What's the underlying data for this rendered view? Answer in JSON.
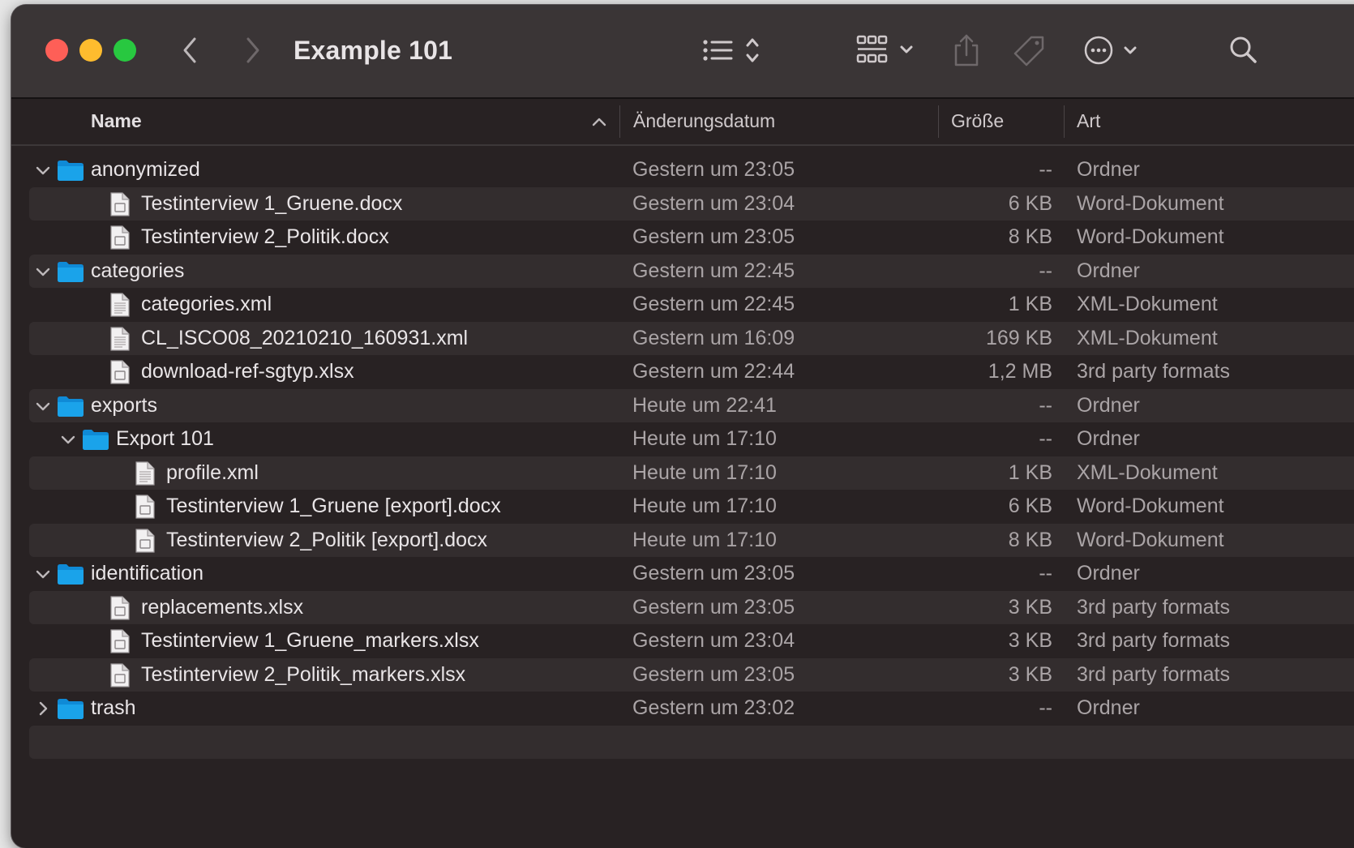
{
  "window": {
    "title": "Example 101"
  },
  "columns": {
    "name": "Name",
    "date": "Änderungsdatum",
    "size": "Größe",
    "kind": "Art"
  },
  "rows": [
    {
      "name": "anonymized",
      "date": "Gestern um 23:05",
      "size": "--",
      "kind": "Ordner",
      "type": "folder",
      "depth": 0,
      "expanded": true
    },
    {
      "name": "Testinterview 1_Gruene.docx",
      "date": "Gestern um 23:04",
      "size": "6 KB",
      "kind": "Word-Dokument",
      "type": "doc",
      "depth": 1
    },
    {
      "name": "Testinterview 2_Politik.docx",
      "date": "Gestern um 23:05",
      "size": "8 KB",
      "kind": "Word-Dokument",
      "type": "doc",
      "depth": 1
    },
    {
      "name": "categories",
      "date": "Gestern um 22:45",
      "size": "--",
      "kind": "Ordner",
      "type": "folder",
      "depth": 0,
      "expanded": true
    },
    {
      "name": "categories.xml",
      "date": "Gestern um 22:45",
      "size": "1 KB",
      "kind": "XML-Dokument",
      "type": "text",
      "depth": 1
    },
    {
      "name": "CL_ISCO08_20210210_160931.xml",
      "date": "Gestern um 16:09",
      "size": "169 KB",
      "kind": "XML-Dokument",
      "type": "text",
      "depth": 1
    },
    {
      "name": "download-ref-sgtyp.xlsx",
      "date": "Gestern um 22:44",
      "size": "1,2 MB",
      "kind": "3rd party formats",
      "type": "doc",
      "depth": 1
    },
    {
      "name": "exports",
      "date": "Heute um 22:41",
      "size": "--",
      "kind": "Ordner",
      "type": "folder",
      "depth": 0,
      "expanded": true
    },
    {
      "name": "Export 101",
      "date": "Heute um 17:10",
      "size": "--",
      "kind": "Ordner",
      "type": "folder",
      "depth": 1,
      "expanded": true
    },
    {
      "name": "profile.xml",
      "date": "Heute um 17:10",
      "size": "1 KB",
      "kind": "XML-Dokument",
      "type": "text",
      "depth": 2
    },
    {
      "name": "Testinterview 1_Gruene [export].docx",
      "date": "Heute um 17:10",
      "size": "6 KB",
      "kind": "Word-Dokument",
      "type": "doc",
      "depth": 2
    },
    {
      "name": "Testinterview 2_Politik [export].docx",
      "date": "Heute um 17:10",
      "size": "8 KB",
      "kind": "Word-Dokument",
      "type": "doc",
      "depth": 2
    },
    {
      "name": "identification",
      "date": "Gestern um 23:05",
      "size": "--",
      "kind": "Ordner",
      "type": "folder",
      "depth": 0,
      "expanded": true
    },
    {
      "name": "replacements.xlsx",
      "date": "Gestern um 23:05",
      "size": "3 KB",
      "kind": "3rd party formats",
      "type": "doc",
      "depth": 1
    },
    {
      "name": "Testinterview 1_Gruene_markers.xlsx",
      "date": "Gestern um 23:04",
      "size": "3 KB",
      "kind": "3rd party formats",
      "type": "doc",
      "depth": 1
    },
    {
      "name": "Testinterview 2_Politik_markers.xlsx",
      "date": "Gestern um 23:05",
      "size": "3 KB",
      "kind": "3rd party formats",
      "type": "doc",
      "depth": 1
    },
    {
      "name": "trash",
      "date": "Gestern um 23:02",
      "size": "--",
      "kind": "Ordner",
      "type": "folder",
      "depth": 0,
      "expanded": false
    }
  ],
  "icons": {
    "back": "chevron-left-icon",
    "forward": "chevron-right-icon",
    "list_view": "list-view-icon",
    "group": "group-icon",
    "share": "share-icon",
    "tag": "tag-icon",
    "more": "ellipsis-circle-icon",
    "search": "search-icon"
  },
  "colors": {
    "folder": "#1aa3ea",
    "close": "#fe5f57",
    "minimize": "#febc2e",
    "zoom": "#28c840"
  }
}
